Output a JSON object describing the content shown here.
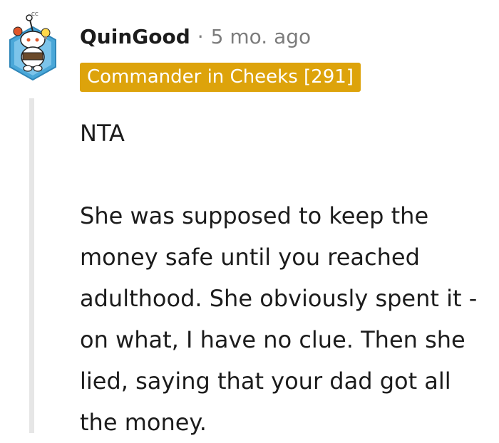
{
  "comment": {
    "username": "QuinGood",
    "separator": "·",
    "timestamp": "5 mo. ago",
    "flair": "Commander in Cheeks [291]",
    "paragraphs": [
      "NTA",
      "She was supposed to keep the money safe until you reached adulthood. She obviously spent it - on what, I have no clue. Then she lied, saying that your dad got all the money."
    ]
  },
  "avatar": {
    "icon": "snoo-avatar-icon",
    "badge_text": "CC"
  },
  "colors": {
    "flair_background": "#dda30b",
    "flair_text": "#ffffff",
    "username": "#1c1c1c",
    "meta": "#7c7c7c",
    "thread_line": "#e6e6e6"
  }
}
